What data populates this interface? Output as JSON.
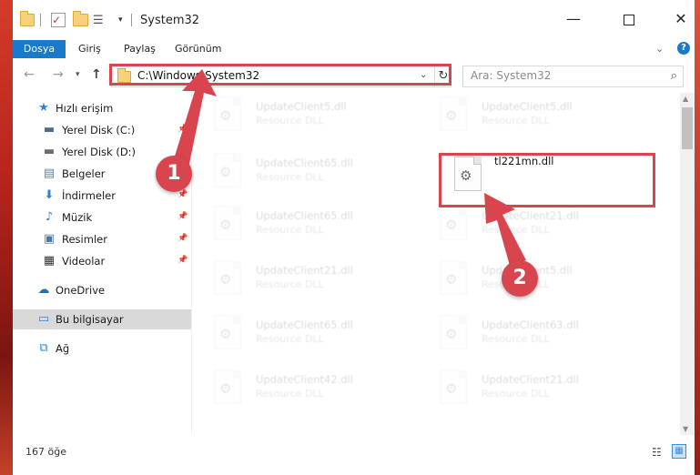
{
  "window": {
    "title": "System32",
    "minimize_label": "—",
    "close_label": "✕"
  },
  "quick_access": {
    "dropdown_glyph": "▾",
    "check_glyph": "✓",
    "props_glyph": "☰"
  },
  "ribbon": {
    "tabs": [
      "Dosya",
      "Giriş",
      "Paylaş",
      "Görünüm"
    ],
    "help_label": "?"
  },
  "address": {
    "path": "C:\\Windows\\System32",
    "search_placeholder": "Ara: System32"
  },
  "sidebar": {
    "items": [
      {
        "label": "Hızlı erişim",
        "icon": "star-icon",
        "glyph": "★",
        "color": "#2f83d6",
        "pinned": false
      },
      {
        "label": "Yerel Disk (C:)",
        "icon": "drive-icon",
        "glyph": "▬",
        "color": "#4a6d8a",
        "pinned": true
      },
      {
        "label": "Yerel Disk (D:)",
        "icon": "drive-icon",
        "glyph": "▬",
        "color": "#6d6d6d",
        "pinned": true
      },
      {
        "label": "Belgeler",
        "icon": "documents-icon",
        "glyph": "▤",
        "color": "#5d7fa6",
        "pinned": true
      },
      {
        "label": "İndirmeler",
        "icon": "download-icon",
        "glyph": "⬇",
        "color": "#2f83d6",
        "pinned": true
      },
      {
        "label": "Müzik",
        "icon": "music-icon",
        "glyph": "♪",
        "color": "#2f83d6",
        "pinned": true
      },
      {
        "label": "Resimler",
        "icon": "pictures-icon",
        "glyph": "▣",
        "color": "#4c7a9e",
        "pinned": true
      },
      {
        "label": "Videolar",
        "icon": "video-icon",
        "glyph": "▦",
        "color": "#333333",
        "pinned": true
      },
      {
        "label": "OneDrive",
        "icon": "cloud-icon",
        "glyph": "☁",
        "color": "#1f6fc0",
        "pinned": false
      },
      {
        "label": "Bu bilgisayar",
        "icon": "computer-icon",
        "glyph": "▭",
        "color": "#2f83d6",
        "pinned": false
      },
      {
        "label": "Ağ",
        "icon": "network-icon",
        "glyph": "⧉",
        "color": "#2f83d6",
        "pinned": false
      }
    ]
  },
  "files": [
    {
      "name": "UpdateClient5.dll",
      "type": "Resource DLL"
    },
    {
      "name": "UpdateClient5.dll",
      "type": "Resource DLL"
    },
    {
      "name": "UpdateClient65.dll",
      "type": "Resource DLL"
    },
    {
      "name": "tl221mn.dll",
      "type": ""
    },
    {
      "name": "UpdateClient65.dll",
      "type": "Resource DLL"
    },
    {
      "name": "UpdateClient21.dll",
      "type": "Resource DLL"
    },
    {
      "name": "UpdateClient21.dll",
      "type": "Resource DLL"
    },
    {
      "name": "UpdateClient5.dll",
      "type": "Resource DLL"
    },
    {
      "name": "UpdateClient65.dll",
      "type": "Resource DLL"
    },
    {
      "name": "UpdateClient63.dll",
      "type": "Resource DLL"
    },
    {
      "name": "UpdateClient42.dll",
      "type": "Resource DLL"
    },
    {
      "name": "UpdateClient21.dll",
      "type": "Resource DLL"
    }
  ],
  "status": {
    "item_count": "167 öğe"
  },
  "annotations": {
    "step1": "1",
    "step2": "2",
    "color": "#d9454f"
  }
}
